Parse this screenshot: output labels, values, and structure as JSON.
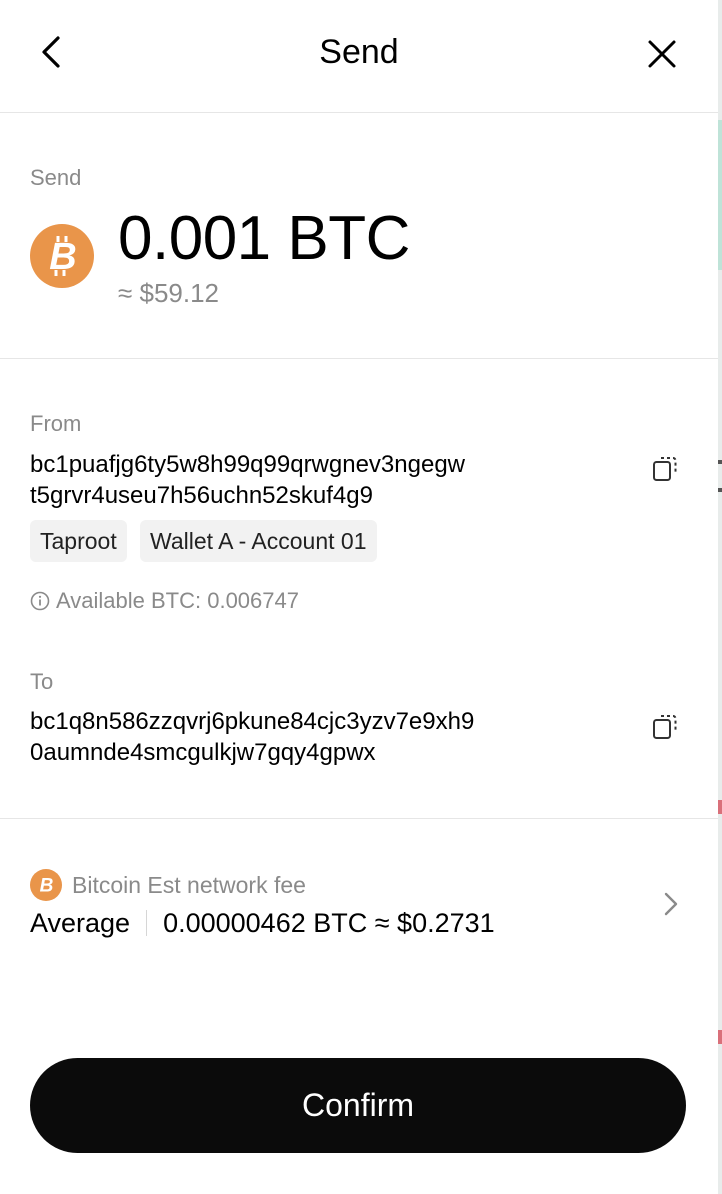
{
  "header": {
    "title": "Send",
    "back_icon": "chevron-left-icon",
    "close_icon": "close-icon"
  },
  "send": {
    "label": "Send",
    "amount": "0.001 BTC",
    "fiat": "≈ $59.12",
    "coin_icon": "bitcoin-icon",
    "coin_color": "#E9954A"
  },
  "from": {
    "label": "From",
    "address_line1": "bc1puafjg6ty5w8h99q99qrwgnev3ngegw",
    "address_line2": "t5grvr4useu7h56uchn52skuf4g9",
    "tags": [
      "Taproot",
      "Wallet A - Account 01"
    ],
    "available": "Available BTC: 0.006747"
  },
  "to": {
    "label": "To",
    "address_line1": "bc1q8n586zzqvrj6pkune84cjc3yzv7e9xh9",
    "address_line2": "0aumnde4smcgulkjw7gqy4gpwx"
  },
  "fee": {
    "label": "Bitcoin Est network fee",
    "speed": "Average",
    "value": "0.00000462 BTC ≈ $0.2731"
  },
  "confirm_label": "Confirm"
}
